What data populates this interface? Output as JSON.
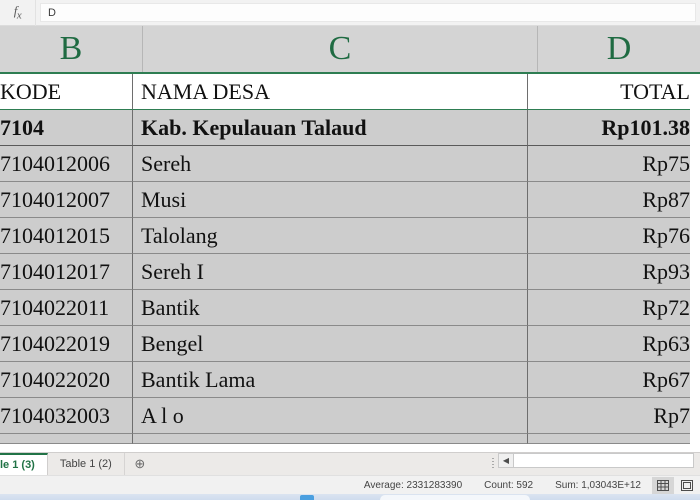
{
  "formula_bar": {
    "fx_icon": "fx-icon",
    "value": "D"
  },
  "grid": {
    "column_headers": [
      "B",
      "C",
      "D"
    ],
    "table_header": {
      "kode": "KODE",
      "nama_desa": "NAMA DESA",
      "total": "TOTAL"
    },
    "summary_row": {
      "kode": "7104",
      "nama_desa": "Kab. Kepulauan Talaud",
      "total": "Rp101.38"
    },
    "rows": [
      {
        "kode": "7104012006",
        "nama_desa": "Sereh",
        "total": "Rp75"
      },
      {
        "kode": "7104012007",
        "nama_desa": "Musi",
        "total": "Rp87"
      },
      {
        "kode": "7104012015",
        "nama_desa": "Talolang",
        "total": "Rp76"
      },
      {
        "kode": "7104012017",
        "nama_desa": "Sereh I",
        "total": "Rp93"
      },
      {
        "kode": "7104022011",
        "nama_desa": "Bantik",
        "total": "Rp72"
      },
      {
        "kode": "7104022019",
        "nama_desa": "Bengel",
        "total": "Rp63"
      },
      {
        "kode": "7104022020",
        "nama_desa": "Bantik Lama",
        "total": "Rp67"
      },
      {
        "kode": "7104032003",
        "nama_desa": "A l o",
        "total": "Rp7"
      }
    ]
  },
  "sheet_tabs": {
    "tabs": [
      {
        "label": "le 1 (3)",
        "active": true
      },
      {
        "label": "Table 1 (2)",
        "active": false
      }
    ],
    "add_label": "⊕"
  },
  "scrollbar": {
    "left_arrow": "◀"
  },
  "statusbar": {
    "average": "Average: 2331283390",
    "count": "Count: 592",
    "sum": "Sum: 1,03043E+12",
    "view_normal": "normal-view-icon",
    "view_layout": "page-layout-icon"
  },
  "colors": {
    "header_green": "#1f6b42",
    "tab_active_green": "#217346",
    "cell_gray": "#cdcdcd",
    "col_header_gray": "#d4d4d4"
  }
}
